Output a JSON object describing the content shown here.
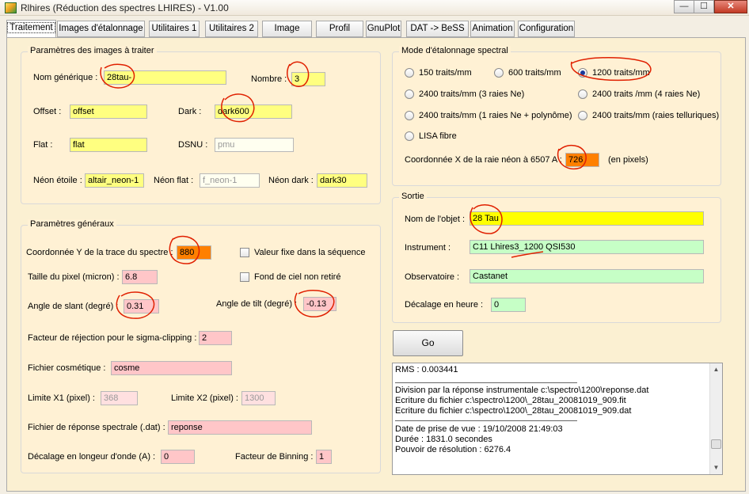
{
  "window": {
    "title": "Rlhires (Réduction des spectres LHIRES) - V1.00"
  },
  "tabs": [
    "Traitement",
    "Images d'étalonnage",
    "Utilitaires 1",
    "Utilitaires 2",
    "Image",
    "Profil",
    "GnuPlot",
    "DAT -> BeSS",
    "Animation",
    "Configuration"
  ],
  "images": {
    "legend": "Paramètres des images à traiter",
    "nom_label": "Nom générique :",
    "nom_value": "28tau-",
    "nombre_label": "Nombre :",
    "nombre_value": "3",
    "offset_label": "Offset :",
    "offset_value": "offset",
    "dark_label": "Dark :",
    "dark_value": "dark600",
    "flat_label": "Flat :",
    "flat_value": "flat",
    "dsnu_label": "DSNU :",
    "dsnu_value": "pmu",
    "neon_etoile_label": "Néon étoile :",
    "neon_etoile_value": "altair_neon-1",
    "neon_flat_label": "Néon flat :",
    "neon_flat_value": "f_neon-1",
    "neon_dark_label": "Néon dark :",
    "neon_dark_value": "dark30"
  },
  "general": {
    "legend": "Paramètres généraux",
    "coordY_label": "Coordonnée Y de la trace du spectre :",
    "coordY_value": "880",
    "valeur_fixe_label": "Valeur fixe dans la séquence",
    "pixel_label": "Taille du pixel (micron) :",
    "pixel_value": "6.8",
    "fond_label": "Fond de ciel non retiré",
    "slant_label": "Angle de slant (degré) :",
    "slant_value": "0.31",
    "tilt_label": "Angle de tilt (degré) :",
    "tilt_value": "-0.13",
    "rejection_label": "Facteur de réjection pour le sigma-clipping :",
    "rejection_value": "2",
    "cosmetique_label": "Fichier cosmétique :",
    "cosmetique_value": "cosme",
    "limx1_label": "Limite X1 (pixel) :",
    "limx1_value": "368",
    "limx2_label": "Limite X2 (pixel) :",
    "limx2_value": "1300",
    "reponse_label": "Fichier de réponse spectrale (.dat) :",
    "reponse_value": "reponse",
    "decalage_label": "Décalage en longeur d'onde (A) :",
    "decalage_value": "0",
    "binning_label": "Facteur de Binning :",
    "binning_value": "1"
  },
  "mode": {
    "legend": "Mode d'étalonnage spectral",
    "r150": "150 traits/mm",
    "r600": "600 traits/mm",
    "r1200": "1200 traits/mm",
    "r2400_3ne": "2400 traits/mm (3 raies Ne)",
    "r2400_4ne": "2400 traits /mm (4 raies Ne)",
    "r2400_poly": "2400 traits/mm (1 raies Ne + polynôme)",
    "r2400_tell": "2400 traits/mm (raies telluriques)",
    "lisa": "LISA fibre",
    "selected": "1200 traits/mm",
    "coordX_label": "Coordonnée X de la raie néon à 6507 A :",
    "coordX_value": "726",
    "coordX_unit": "(en pixels)"
  },
  "sortie": {
    "legend": "Sortie",
    "objet_label": "Nom de l'objet :",
    "objet_value": "28 Tau",
    "instrument_label": "Instrument :",
    "instrument_value": "C11 Lhires3_1200 QSI530",
    "observatoire_label": "Observatoire :",
    "observatoire_value": "Castanet",
    "decalage_label": "Décalage en heure :",
    "decalage_value": "0"
  },
  "go_label": "Go",
  "log": {
    "rms": "RMS : 0.003441",
    "division": "Division par la réponse instrumentale c:\\spectro\\1200\\reponse.dat",
    "ecriture1": "Ecriture du fichier c:\\spectro\\1200\\_28tau_20081019_909.fit",
    "ecriture2": "Ecriture du fichier c:\\spectro\\1200\\_28tau_20081019_909.dat",
    "date": "Date de prise de vue : 19/10/2008 21:49:03",
    "duree": "Durée : 1831.0 secondes",
    "pouvoir": "Pouvoir de résolution : 6276.4"
  },
  "colors": {
    "required": "#ffff80",
    "highlight": "#ffff00",
    "orange": "#ff8000",
    "pink": "#ffc6c8",
    "green": "#c6ffc6",
    "annotation": "#e02000"
  }
}
